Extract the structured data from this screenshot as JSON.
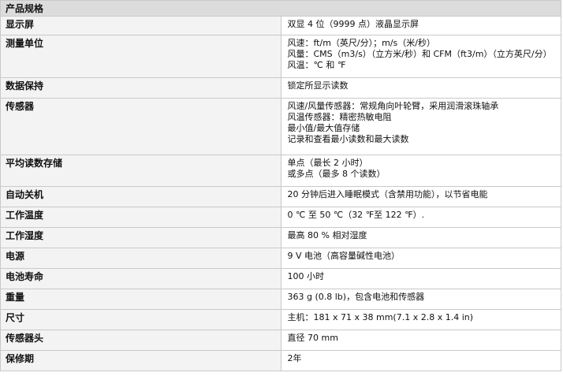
{
  "header": "产品规格",
  "rows": [
    {
      "label": "显示屏",
      "lines": [
        "双显 4 位（9999 点）液晶显示屏"
      ]
    },
    {
      "label": "测量单位",
      "lines": [
        "风速：ft/m（英尺/分）；m/s（米/秒）",
        "风量：CMS（m3/s）（立方米/秒）和 CFM（ft3/m）（立方英尺/分）",
        "风温：℃ 和 ℉"
      ]
    },
    {
      "label": "数据保持",
      "lines": [
        "锁定所显示读数"
      ]
    },
    {
      "label": "传感器",
      "lines": [
        "风速/风量传感器：常规角向叶轮臂，采用润滑滚珠轴承",
        "风温传感器：精密热敏电阻",
        "最小值/最大值存储",
        "记录和查看最小读数和最大读数"
      ]
    },
    {
      "label": "平均读数存储",
      "lines": [
        "单点（最长 2 小时）",
        "或多点（最多 8 个读数）"
      ]
    },
    {
      "label": "自动关机",
      "lines": [
        "20 分钟后进入睡眠模式（含禁用功能），以节省电能"
      ]
    },
    {
      "label": "工作温度",
      "lines": [
        "0 ℃ 至 50 ℃（32 ℉至 122 ℉）."
      ]
    },
    {
      "label": "工作湿度",
      "lines": [
        "最高 80 % 相对湿度"
      ]
    },
    {
      "label": "电源",
      "lines": [
        "9 V 电池（高容量碱性电池）"
      ]
    },
    {
      "label": "电池寿命",
      "lines": [
        "100 小时"
      ]
    },
    {
      "label": "重量",
      "lines": [
        "363 g (0.8 lb)，包含电池和传感器"
      ]
    },
    {
      "label": "尺寸",
      "lines": [
        "主机：181 x 71 x 38 mm(7.1 x 2.8 x 1.4 in)"
      ]
    },
    {
      "label": "传感器头",
      "lines": [
        "直径 70 mm"
      ]
    },
    {
      "label": "保修期",
      "lines": [
        "2年"
      ]
    }
  ]
}
